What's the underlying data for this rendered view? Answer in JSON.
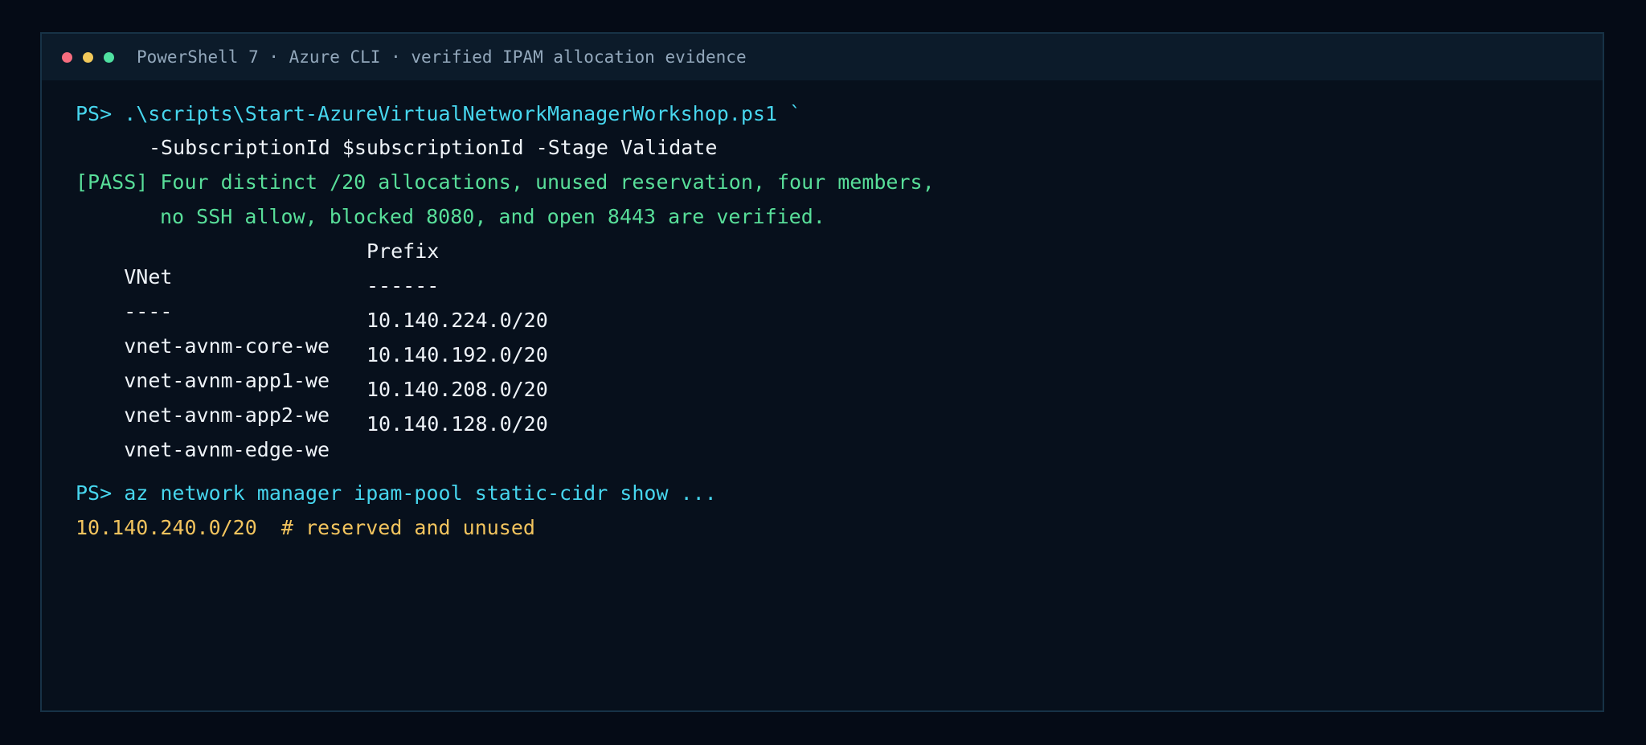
{
  "window": {
    "title": "PowerShell 7 · Azure CLI · verified IPAM allocation evidence"
  },
  "colors": {
    "background": "#050b16",
    "terminal": "#07101c",
    "titlebar": "#0c1b2a",
    "command": "#47d6ee",
    "pass": "#58de99",
    "text": "#eef3f8",
    "reserved": "#f2c45e"
  },
  "terminal": {
    "command1_line1": "PS> .\\scripts\\Start-AzureVirtualNetworkManagerWorkshop.ps1 `",
    "command1_line2": "-SubscriptionId $subscriptionId -Stage Validate",
    "pass_line1": "[PASS] Four distinct /20 allocations, unused reservation, four members,",
    "pass_line2": "no SSH allow, blocked 8080, and open 8443 are verified.",
    "table": {
      "headers": [
        "VNet",
        "Prefix"
      ],
      "separators": [
        "----",
        "------"
      ],
      "rows": [
        [
          "vnet-avnm-core-we",
          "10.140.224.0/20"
        ],
        [
          "vnet-avnm-app1-we",
          "10.140.192.0/20"
        ],
        [
          "vnet-avnm-app2-we",
          "10.140.208.0/20"
        ],
        [
          "vnet-avnm-edge-we",
          "10.140.128.0/20"
        ]
      ]
    },
    "command2": "PS> az network manager ipam-pool static-cidr show ...",
    "result": "10.140.240.0/20  # reserved and unused"
  }
}
